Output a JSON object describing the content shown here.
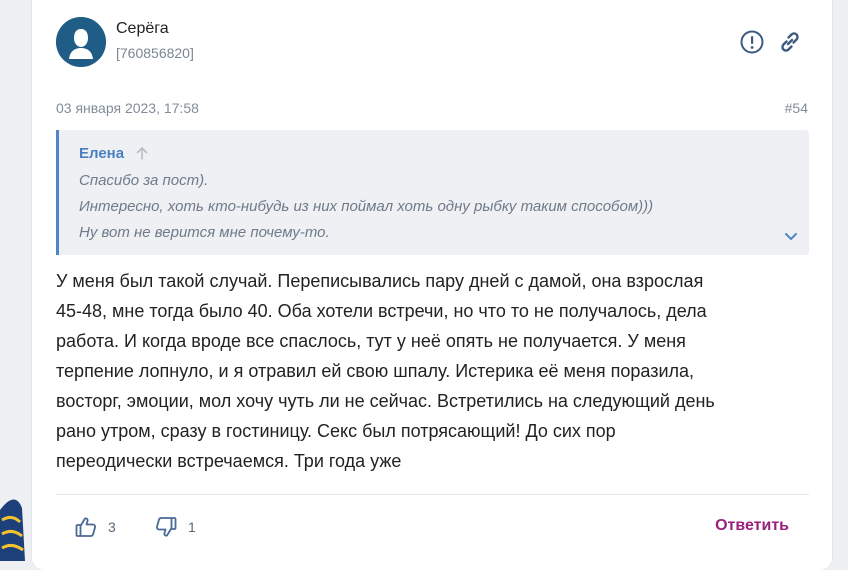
{
  "post": {
    "author": "Серёга",
    "author_id": "[760856820]",
    "date": "03 января 2023, 17:58",
    "number": "#54",
    "quote": {
      "author": "Елена",
      "lines": [
        "Спасибо за пост).",
        "Интересно, хоть кто-нибудь из них поймал хоть одну рыбку таким способом)))",
        "Ну вот не верится мне почему-то."
      ]
    },
    "body_lines": [
      "У меня был такой случай. Переписывались пару дней с дамой, она взрослая",
      "45-48, мне тогда было 40. Оба хотели встречи, но что то не получалось, дела",
      "работа. И когда вроде все спаслось, тут у неё опять не получается. У меня",
      "терпение лопнуло, и я отравил ей свою шпалу. Истерика её меня поразила,",
      "восторг, эмоции, мол хочу чуть ли не сейчас. Встретились на следующий день",
      "рано утром, сразу в гостиницу. Секс был потрясающий! До сих пор",
      "переодически встречаемся. Три года уже"
    ],
    "likes": "3",
    "dislikes": "1",
    "reply_label": "Ответить"
  },
  "icons": {
    "report": "exclamation-circle-icon",
    "link": "link-icon",
    "like": "thumbs-up-icon",
    "dislike": "thumbs-down-icon",
    "quote_up": "arrow-up-icon",
    "expand": "chevron-down-icon"
  },
  "colors": {
    "avatar_bg": "#1f5c86",
    "quote_border": "#4f86c6",
    "quote_author": "#4a7fc0",
    "reply": "#9a1f7a",
    "icon": "#3d5a80"
  }
}
